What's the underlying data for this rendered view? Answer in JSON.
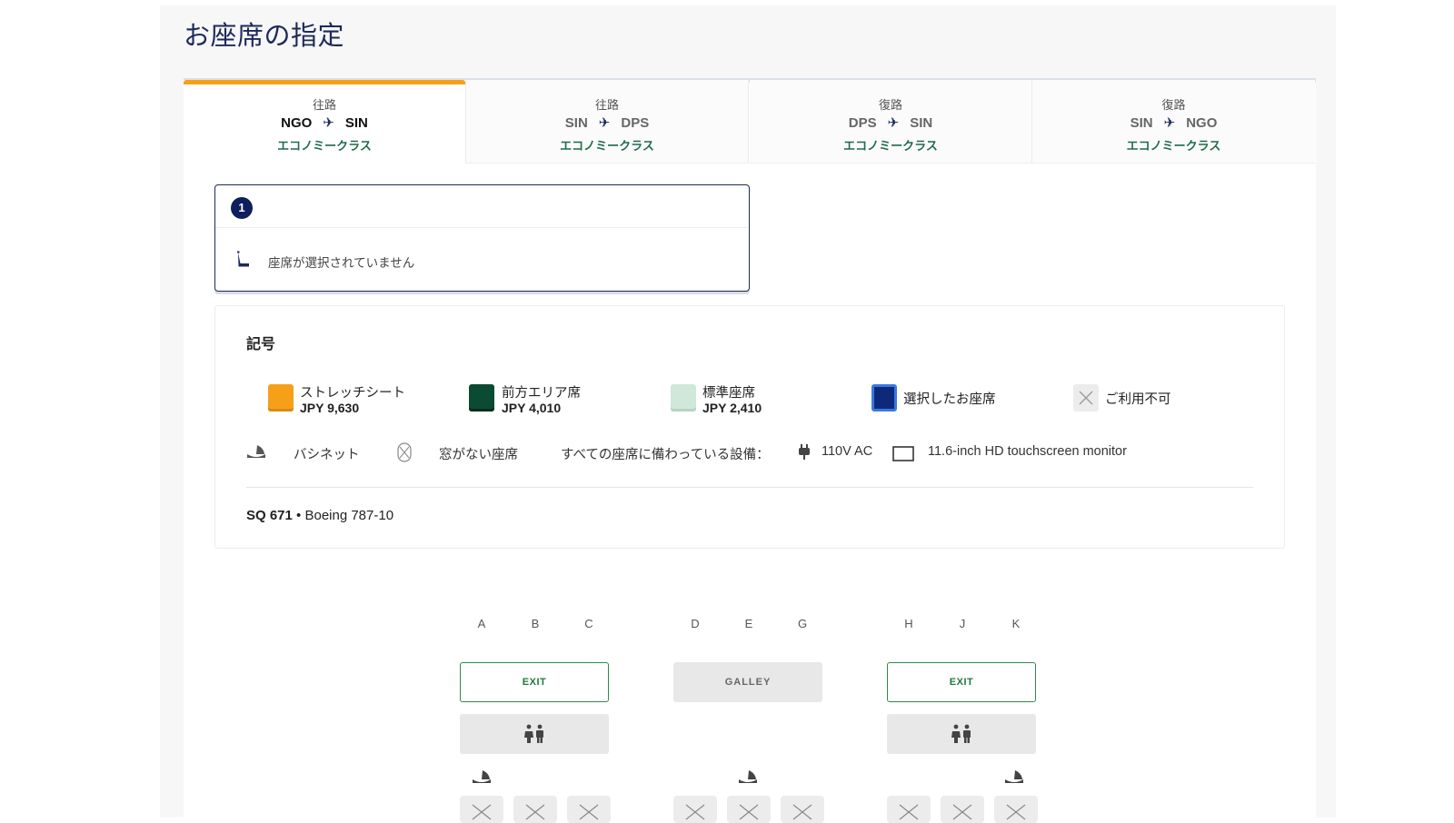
{
  "page": {
    "title": "お座席の指定"
  },
  "tabs": [
    {
      "direction": "往路",
      "from": "NGO",
      "to": "SIN",
      "cabin": "エコノミークラス",
      "active": true
    },
    {
      "direction": "往路",
      "from": "SIN",
      "to": "DPS",
      "cabin": "エコノミークラス",
      "active": false
    },
    {
      "direction": "復路",
      "from": "DPS",
      "to": "SIN",
      "cabin": "エコノミークラス",
      "active": false
    },
    {
      "direction": "復路",
      "from": "SIN",
      "to": "NGO",
      "cabin": "エコノミークラス",
      "active": false
    }
  ],
  "passenger": {
    "number": "1",
    "seat_status": "座席が選択されていません"
  },
  "legend": {
    "title": "記号",
    "items": [
      {
        "label": "ストレッチシート",
        "price": "JPY 9,630",
        "color": "#f6a01a"
      },
      {
        "label": "前方エリア席",
        "price": "JPY 4,010",
        "color": "#0b4a33"
      },
      {
        "label": "標準座席",
        "price": "JPY 2,410",
        "color": "#cfe8d9"
      },
      {
        "label": "選択したお座席",
        "price": "",
        "color": "#0d2a7a"
      },
      {
        "label": "ご利用不可",
        "price": "",
        "color": "#e8e8e8"
      }
    ],
    "bassinet_label": "バシネット",
    "no_window_label": "窓がない座席",
    "amenities_prefix": "すべての座席に備わっている設備：",
    "power_label": "110V AC",
    "monitor_label": "11.6-inch HD touchscreen monitor"
  },
  "flight": {
    "number": "SQ 671",
    "separator": " • ",
    "aircraft": "Boeing 787-10"
  },
  "seatmap": {
    "columns": [
      "A",
      "B",
      "C",
      "D",
      "E",
      "G",
      "H",
      "J",
      "K"
    ],
    "exit_label": "EXIT",
    "galley_label": "GALLEY"
  }
}
